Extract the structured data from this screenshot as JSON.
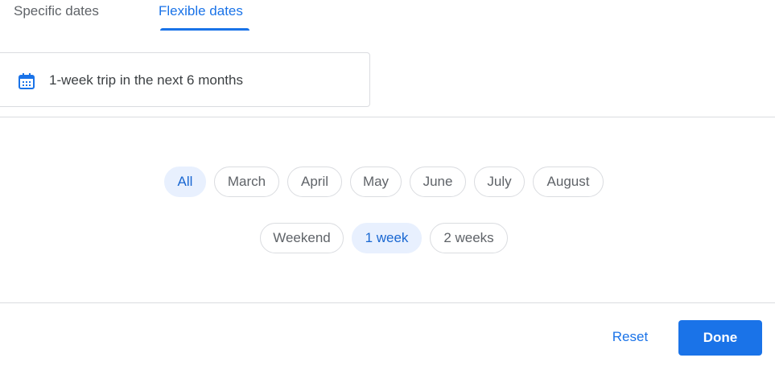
{
  "tabs": {
    "specific": "Specific dates",
    "flexible": "Flexible dates",
    "active": "flexible"
  },
  "summary": {
    "icon": "calendar-icon",
    "text": "1-week trip in the next 6 months"
  },
  "months": {
    "items": [
      "All",
      "March",
      "April",
      "May",
      "June",
      "July",
      "August"
    ],
    "selected": "All"
  },
  "durations": {
    "items": [
      "Weekend",
      "1 week",
      "2 weeks"
    ],
    "selected": "1 week"
  },
  "footer": {
    "reset_label": "Reset",
    "done_label": "Done"
  },
  "colors": {
    "accent": "#1a73e8",
    "selected_chip_bg": "#e8f0fe",
    "selected_chip_text": "#1967d2",
    "text_muted": "#5f6368",
    "divider": "#dadce0"
  }
}
